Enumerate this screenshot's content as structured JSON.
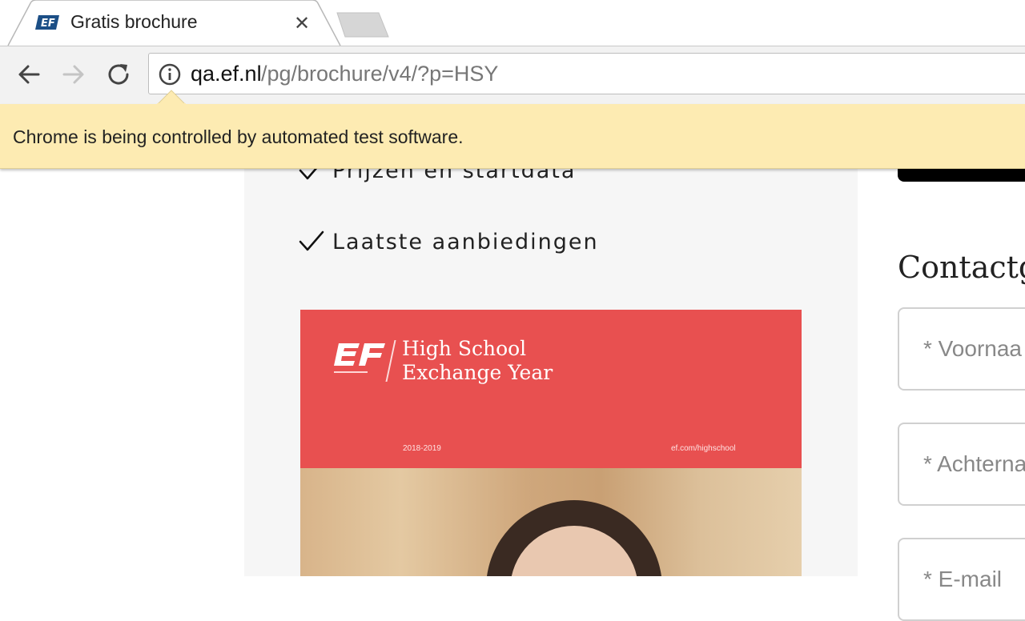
{
  "browser": {
    "tab": {
      "title": "Gratis brochure",
      "favicon": "EF",
      "close_glyph": "✕"
    },
    "address_bar": {
      "host": "qa.ef.nl",
      "path": "/pg/brochure/v4/?p=HSY"
    },
    "infobar": {
      "message": "Chrome is being controlled by automated test software."
    },
    "icons": [
      "back-arrow-icon",
      "forward-arrow-icon",
      "reload-icon",
      "info-icon",
      "close-icon"
    ]
  },
  "page": {
    "benefits": [
      {
        "label": "Prijzen en startdata"
      },
      {
        "label": "Laatste aanbiedingen"
      }
    ],
    "brochure": {
      "title_line1": "High School",
      "title_line2": "Exchange Year",
      "years": "2018-2019",
      "website": "ef.com/highschool",
      "cover_color": "#e85050"
    },
    "contact": {
      "heading": "Contactgeg",
      "fields": [
        {
          "placeholder": "* Voornaa"
        },
        {
          "placeholder": "* Achterna"
        },
        {
          "placeholder": "* E-mail"
        }
      ]
    }
  },
  "colors": {
    "infobar": "#fdebb2",
    "panel": "#f6f6f6",
    "brochure_red": "#e85050"
  }
}
